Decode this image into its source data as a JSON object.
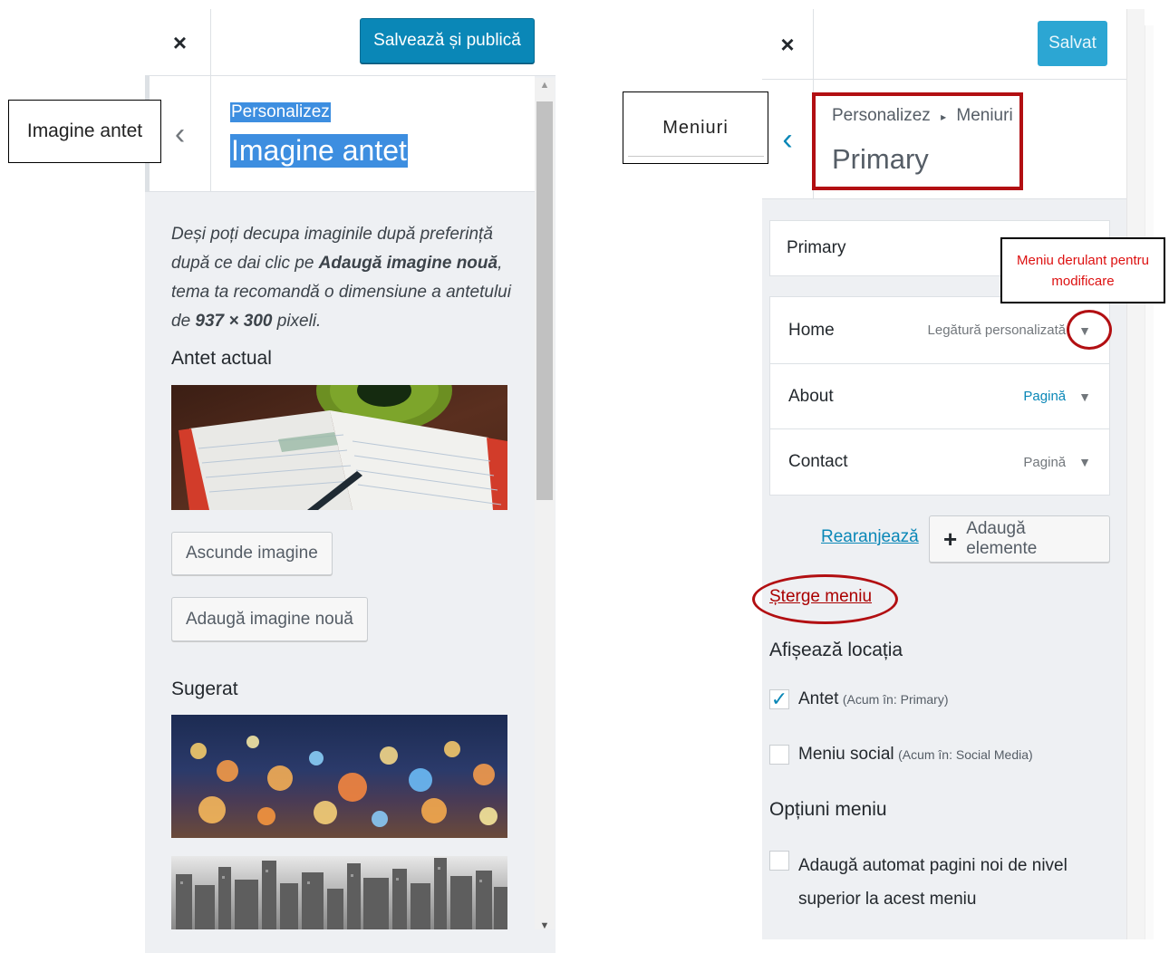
{
  "left_panel": {
    "save_button": "Salvează și publică",
    "breadcrumb": "Personalizez",
    "title": "Imagine antet",
    "description": {
      "part1": "Deși poți decupa imaginile după preferință după ce dai clic pe ",
      "bold1": "Adaugă imagine nouă",
      "part2": ", tema ta recomandă o dimensiune a antetului de ",
      "bold2": "937 × 300",
      "part3": " pixeli."
    },
    "current_header_title": "Antet actual",
    "hide_image_button": "Ascunde imagine",
    "add_image_button": "Adaugă imagine nouă",
    "suggested_title": "Sugerat"
  },
  "left_callout": "Imagine antet",
  "right_panel": {
    "save_button": "Salvat",
    "breadcrumb_root": "Personalizez",
    "breadcrumb_sep": "▸",
    "breadcrumb_current": "Meniuri",
    "title": "Primary",
    "menu_name_value": "Primary",
    "menu_items": [
      {
        "label": "Home",
        "type": "Legătură personalizată"
      },
      {
        "label": "About",
        "type": "Pagină"
      },
      {
        "label": "Contact",
        "type": "Pagină"
      }
    ],
    "reorder_link": "Rearanjează",
    "add_items_button": "Adaugă elemente",
    "delete_menu_link": "Șterge meniu",
    "locations_title": "Afișează locația",
    "locations": [
      {
        "label": "Antet",
        "sub": "(Acum în: Primary)",
        "checked": true
      },
      {
        "label": "Meniu social",
        "sub": "(Acum în: Social Media)",
        "checked": false
      }
    ],
    "options_title": "Opțiuni meniu",
    "auto_add_label": "Adaugă automat pagini noi de nivel superior la acest meniu"
  },
  "right_callout": "Meniuri",
  "dropdown_callout": "Meniu derulant pentru modificare",
  "colors": {
    "primary_blue": "#0a87b7",
    "panel_bg": "#eef0f3",
    "highlight": "#3d8ee0",
    "annotation_red": "#b20f12"
  }
}
